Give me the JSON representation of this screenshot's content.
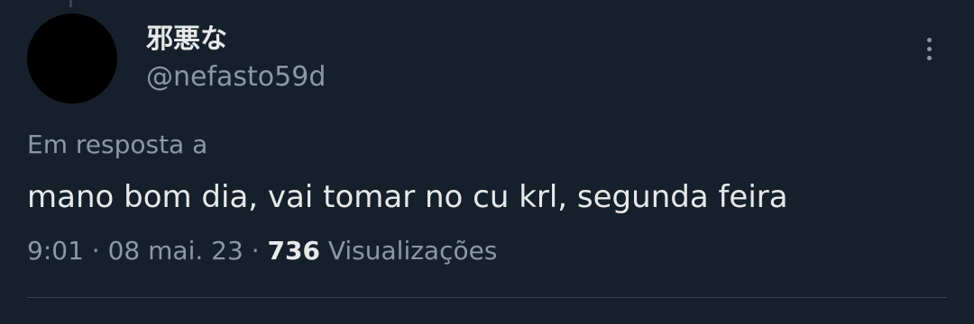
{
  "tweet": {
    "display_name": "邪悪な",
    "handle": "@nefasto59d",
    "reply_context": "Em resposta a",
    "text": "mano bom dia, vai tomar no cu krl, segunda feira",
    "time": "9:01",
    "separator": "·",
    "date": "08 mai. 23",
    "views_count": "736",
    "views_label": "Visualizações"
  },
  "colors": {
    "background": "#15202b",
    "primary_text": "#e7e9ea",
    "secondary_text": "#8b98a5",
    "divider": "#38444d",
    "avatar": "#000000"
  },
  "icons": {
    "more": "more-vertical-icon"
  }
}
